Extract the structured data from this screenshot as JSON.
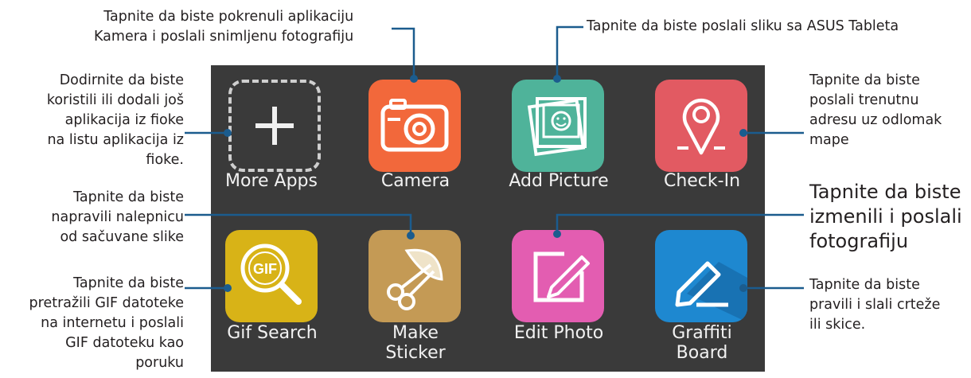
{
  "callouts": {
    "camera": [
      "Tapnite da biste pokrenuli aplikaciju",
      "Kamera i poslali snimljenu fotografiju"
    ],
    "add_picture": "Tapnite da biste poslali sliku sa ASUS Tableta",
    "more_apps": [
      "Dodirnite da biste",
      "koristili ili dodali još",
      "aplikacija iz fioke",
      "na listu aplikacija iz",
      "fioke."
    ],
    "check_in": [
      "Tapnite da biste",
      "poslali trenutnu",
      "adresu uz odlomak",
      "mape"
    ],
    "make_sticker": [
      "Tapnite da biste",
      "napravili nalepnicu",
      "od sačuvane slike"
    ],
    "edit_photo": [
      "Tapnite da biste",
      "izmenili i poslali",
      "fotografiju"
    ],
    "gif_search": [
      "Tapnite da biste",
      "pretražili GIF datoteke",
      "na internetu i poslali",
      "GIF datoteku kao",
      "poruku"
    ],
    "graffiti": [
      "Tapnite da biste",
      "pravili i slali crteže",
      "ili skice."
    ]
  },
  "apps": [
    {
      "name": "More Apps",
      "color": "transparent",
      "icon": "plus-icon"
    },
    {
      "name": "Camera",
      "color": "#f2683b",
      "icon": "camera-icon"
    },
    {
      "name": "Add Picture",
      "color": "#4fb39a",
      "icon": "picture-icon"
    },
    {
      "name": "Check-In",
      "color": "#e25a62",
      "icon": "location-pin-icon"
    },
    {
      "name": "Gif Search",
      "color": "#d8b317",
      "icon": "gif-search-icon"
    },
    {
      "name": [
        "Make",
        "Sticker"
      ],
      "color": "#c49a55",
      "icon": "scissors-icon"
    },
    {
      "name": "Edit Photo",
      "color": "#e35db1",
      "icon": "pencil-edit-icon"
    },
    {
      "name": [
        "Graffiti",
        "Board"
      ],
      "color": "#1e88d0",
      "icon": "pen-draw-icon"
    }
  ],
  "leader_color": "#1b5c8e"
}
